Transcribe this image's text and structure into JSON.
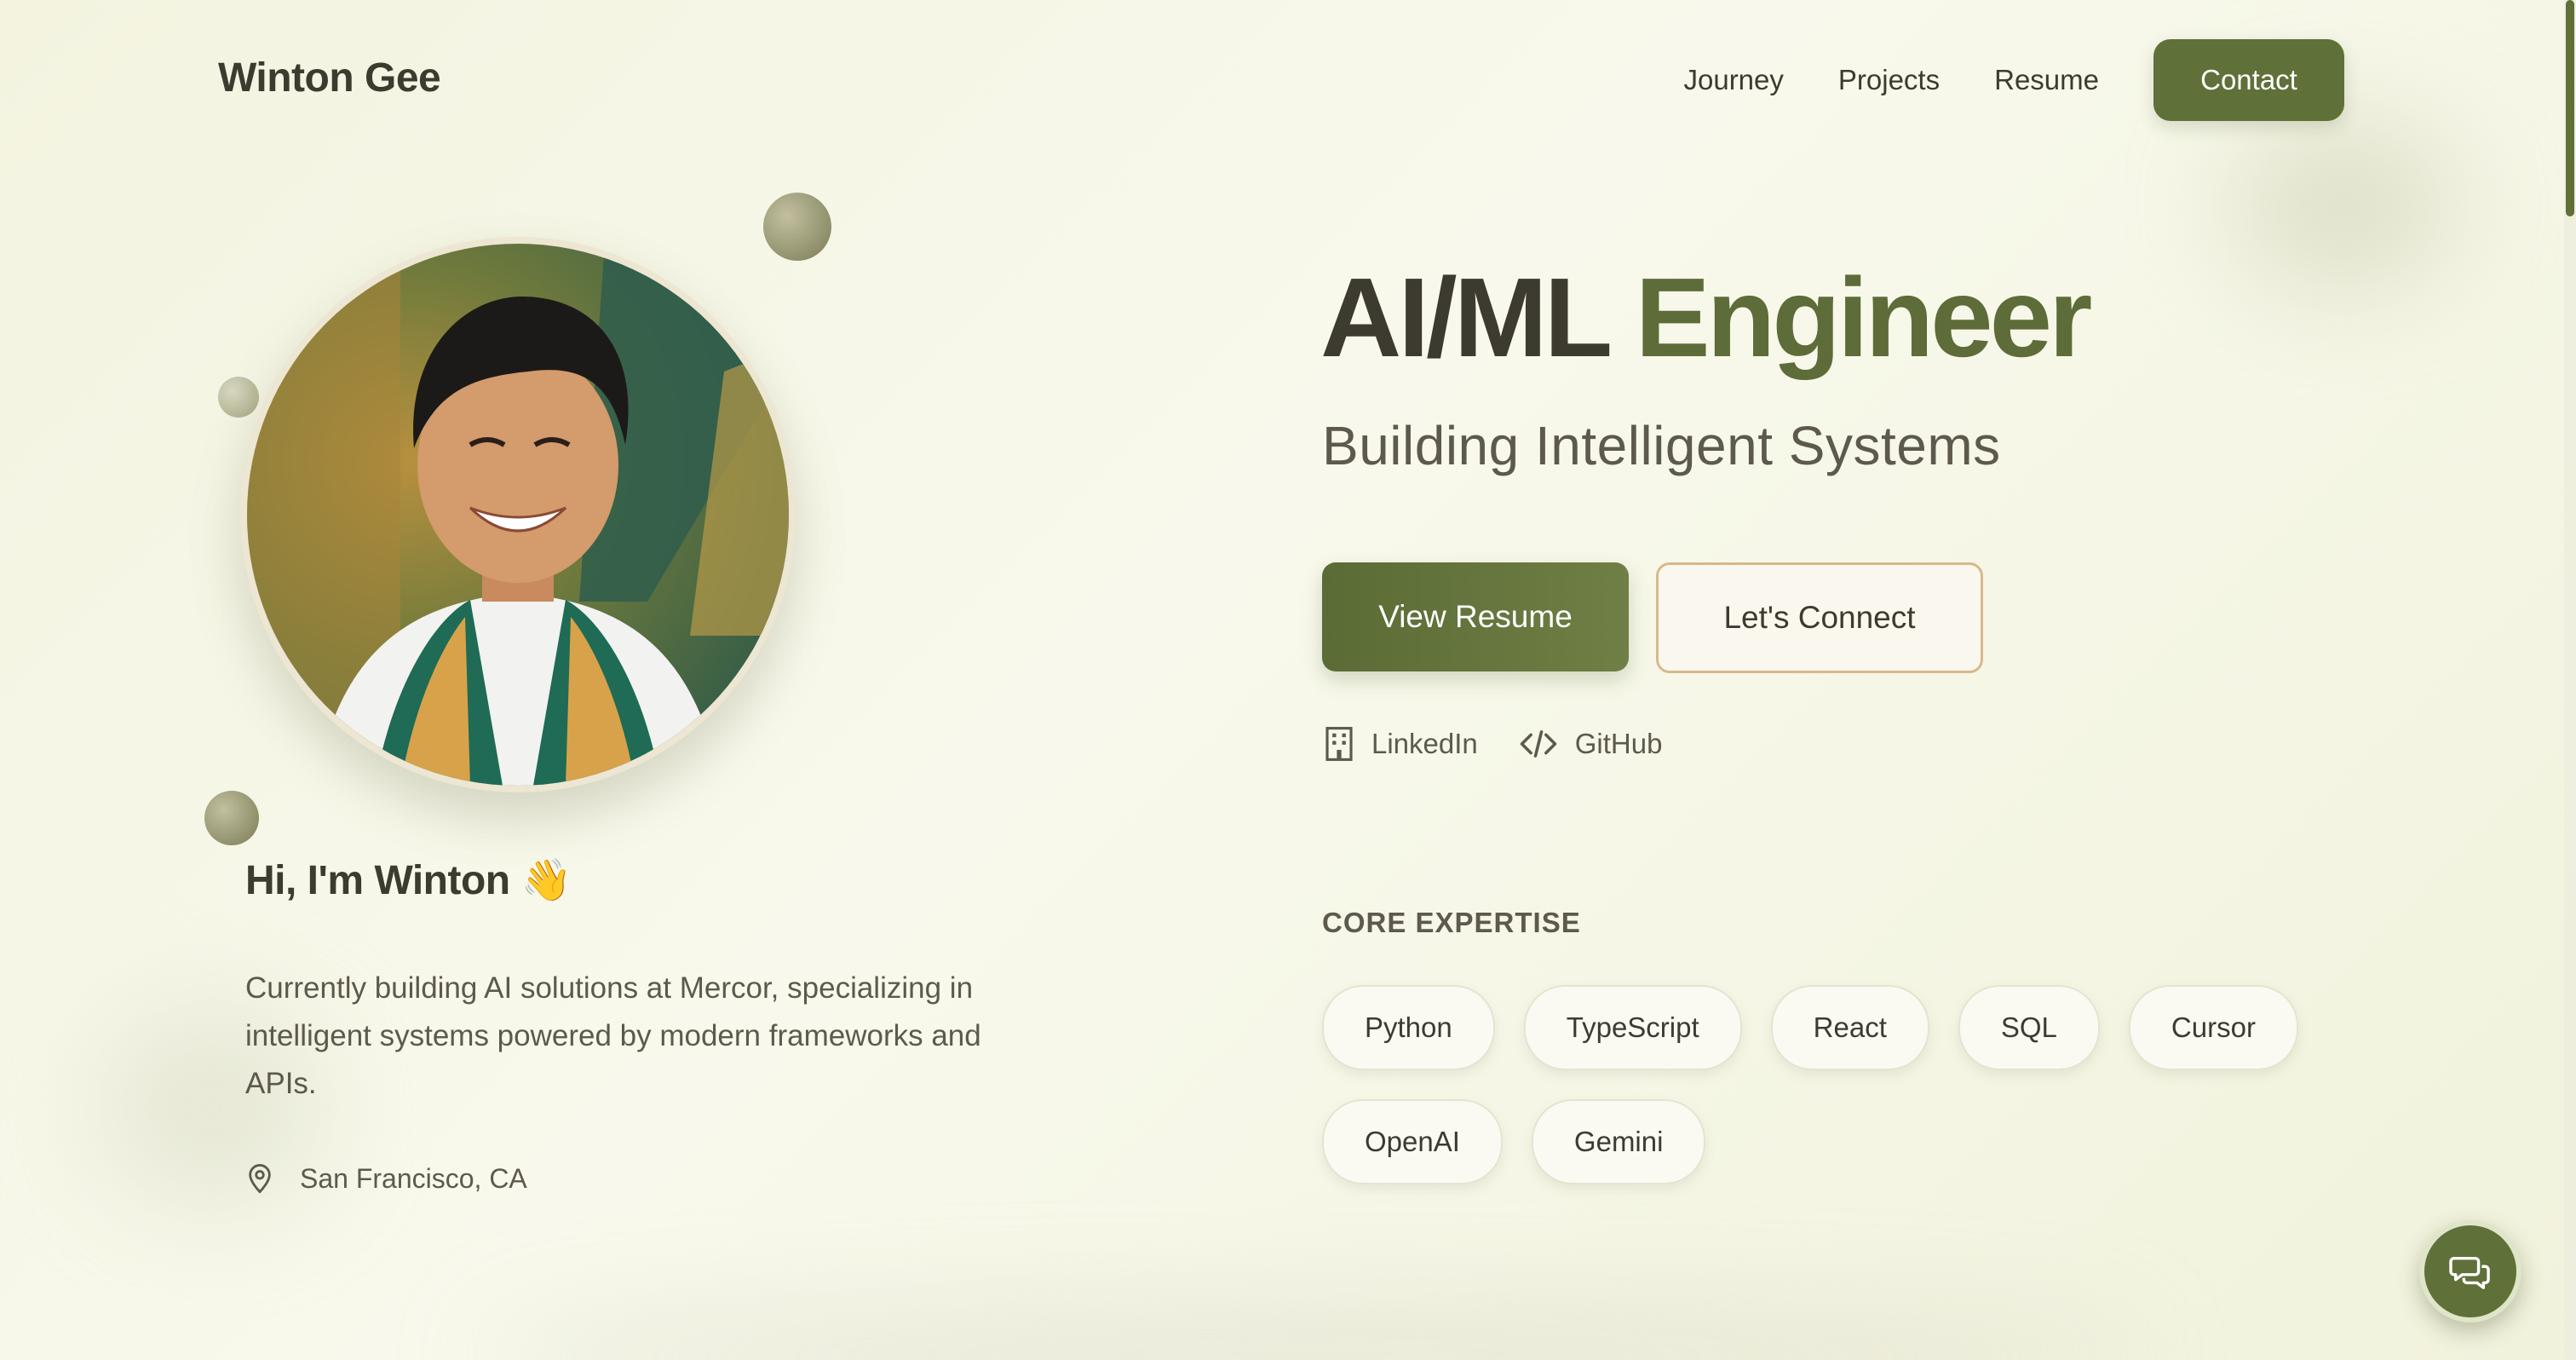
{
  "header": {
    "brand": "Winton Gee",
    "nav": [
      {
        "label": "Journey"
      },
      {
        "label": "Projects"
      },
      {
        "label": "Resume"
      }
    ],
    "contact_label": "Contact"
  },
  "profile": {
    "greeting": "Hi, I'm Winton",
    "greeting_emoji": "👋",
    "bio": "Currently building AI solutions at Mercor, specializing in intelligent systems powered by modern frameworks and APIs.",
    "location": "San Francisco, CA",
    "location_icon": "map-pin-icon"
  },
  "hero": {
    "title_part1": "AI/ML",
    "title_part2": "Engineer",
    "subtitle": "Building Intelligent Systems",
    "primary_button": "View Resume",
    "secondary_button": "Let's Connect",
    "socials": [
      {
        "label": "LinkedIn",
        "icon": "building-icon"
      },
      {
        "label": "GitHub",
        "icon": "code-icon"
      }
    ]
  },
  "expertise": {
    "heading": "CORE EXPERTISE",
    "skills": [
      "Python",
      "TypeScript",
      "React",
      "SQL",
      "Cursor",
      "OpenAI",
      "Gemini"
    ]
  },
  "colors": {
    "accent": "#5f7039",
    "text": "#3d3a30",
    "muted": "#5d594c",
    "outline": "#d8b88d",
    "background": "#f5f6e6"
  },
  "chat": {
    "icon": "chat-bubbles-icon"
  }
}
